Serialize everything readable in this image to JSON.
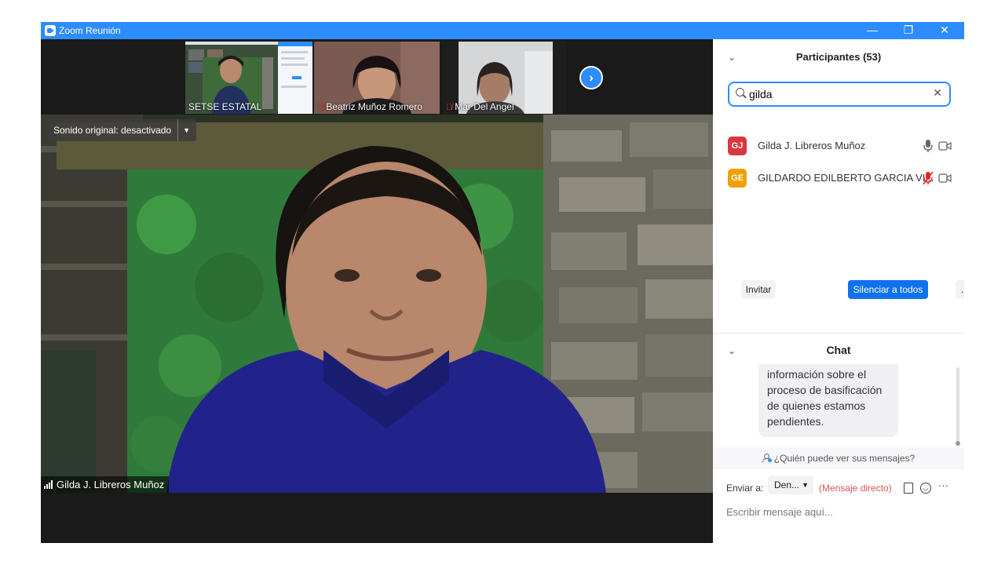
{
  "window": {
    "title": "Zoom Reunión",
    "minimize_glyph": "—",
    "maximize_glyph": "❐",
    "close_glyph": "✕"
  },
  "thumbnails": [
    {
      "name": "SETSE ESTATAL",
      "muted": false
    },
    {
      "name": "Beatriz Muñoz Romero",
      "muted": true
    },
    {
      "name": "Mar Del Angel",
      "muted": true
    }
  ],
  "next_icon": "›",
  "main_video": {
    "audio_pill": "Sonido original: desactivado",
    "audio_pill_arrow": "▼",
    "speaker_name": "Gilda J. Libreros Muñoz"
  },
  "participants": {
    "title": "Participantes (53)",
    "collapse_icon": "chevron-down",
    "search_value": "gilda",
    "clear_glyph": "✕",
    "list": [
      {
        "initials": "GJ",
        "name": "Gilda J. Libreros Muñoz",
        "color": "#d9363e",
        "mic_muted": false
      },
      {
        "initials": "GE",
        "name": "GILDARDO EDILBERTO GARCIA VI...",
        "color": "#f0a000",
        "mic_muted": true
      }
    ],
    "buttons": {
      "invite": "Invitar",
      "mute_all": "Silenciar a todos",
      "more": "..."
    }
  },
  "chat": {
    "title": "Chat",
    "message": "información sobre el proceso de basificación de quienes estamos pendientes.",
    "who_can_see": "¿Quién puede ver sus mensajes?",
    "send_to_label": "Enviar a:",
    "send_to_value": "Den...",
    "direct_message": "(Mensaje directo)",
    "input_placeholder": "Escribir mensaje aquí...",
    "more_glyph": "···"
  },
  "colors": {
    "zoom_blue": "#2d8cff",
    "mute_all_button": "#0e72ed",
    "muted_red": "#ff4d4d",
    "dm_red": "#d9534f"
  }
}
